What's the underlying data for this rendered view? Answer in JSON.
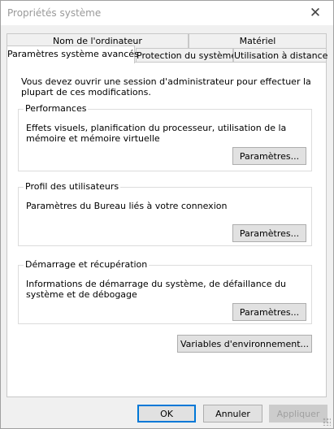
{
  "window": {
    "title": "Propriétés système"
  },
  "tabs_back": [
    {
      "label": "Nom de l'ordinateur"
    },
    {
      "label": "Matériel"
    }
  ],
  "tabs_front": [
    {
      "label": "Paramètres système avancés",
      "active": true
    },
    {
      "label": "Protection du système"
    },
    {
      "label": "Utilisation à distance"
    }
  ],
  "panel": {
    "intro": "Vous devez ouvrir une session d'administrateur pour effectuer la plupart de ces modifications.",
    "performance": {
      "title": "Performances",
      "description": "Effets visuels, planification du processeur, utilisation de la mémoire et mémoire virtuelle",
      "button": "Paramètres..."
    },
    "profiles": {
      "title": "Profil des utilisateurs",
      "description": "Paramètres du Bureau liés à votre connexion",
      "button": "Paramètres..."
    },
    "startup": {
      "title": "Démarrage et récupération",
      "description": "Informations de démarrage du système, de défaillance du système et de débogage",
      "button": "Paramètres..."
    },
    "env_button": "Variables d'environnement..."
  },
  "footer": {
    "ok": "OK",
    "cancel": "Annuler",
    "apply": "Appliquer"
  }
}
